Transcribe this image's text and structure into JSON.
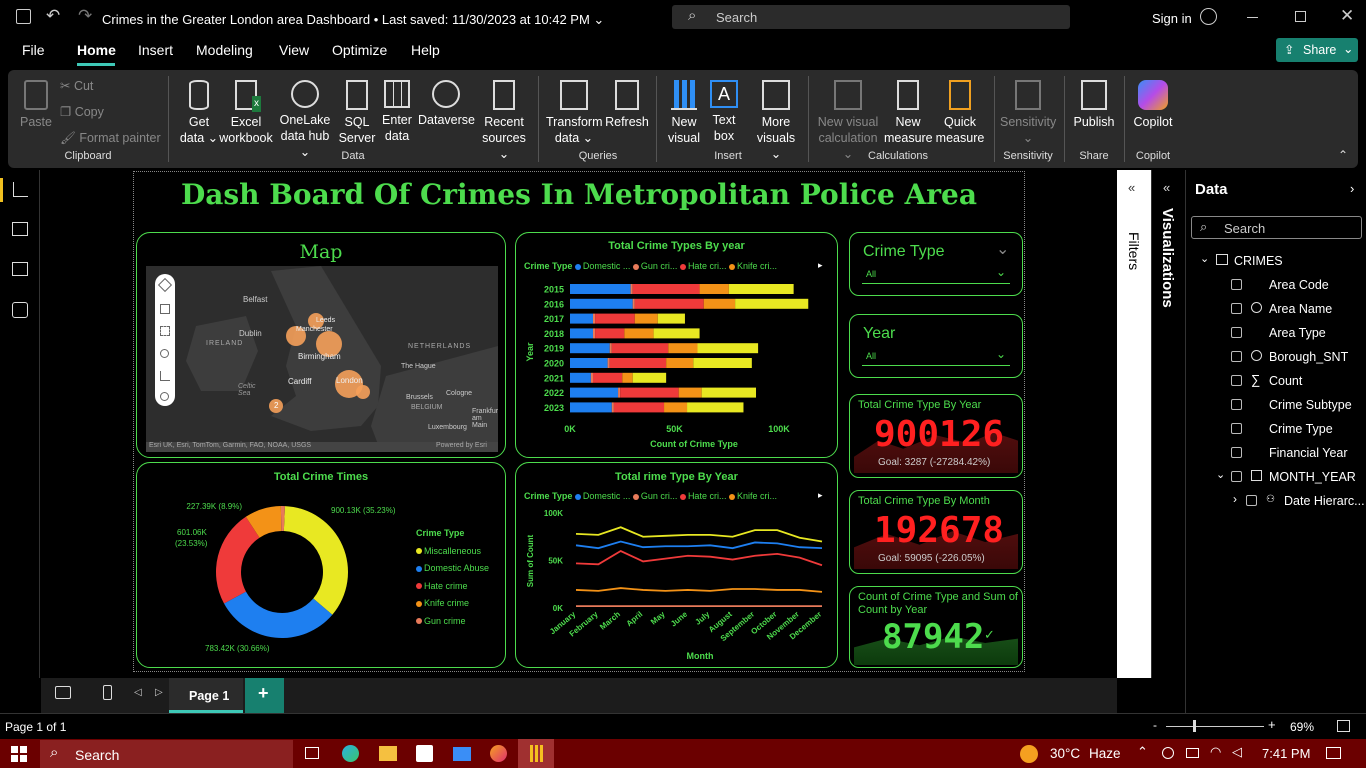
{
  "titlebar": {
    "doc_title": "Crimes in the Greater London area Dashboard",
    "saved": "Last saved: 11/30/2023 at 10:42 PM",
    "search_placeholder": "Search",
    "sign_in": "Sign in"
  },
  "menu": {
    "items": [
      "File",
      "Home",
      "Insert",
      "Modeling",
      "View",
      "Optimize",
      "Help"
    ],
    "share": "Share"
  },
  "ribbon": {
    "paste": "Paste",
    "cut": "Cut",
    "copy": "Copy",
    "format_painter": "Format painter",
    "get_data": [
      "Get",
      "data ⌄"
    ],
    "excel": [
      "Excel",
      "workbook"
    ],
    "onelake": [
      "OneLake",
      "data hub ⌄"
    ],
    "sql": [
      "SQL",
      "Server"
    ],
    "enter": [
      "Enter",
      "data"
    ],
    "dataverse": "Dataverse",
    "recent": [
      "Recent",
      "sources ⌄"
    ],
    "transform": [
      "Transform",
      "data ⌄"
    ],
    "refresh": "Refresh",
    "new_visual": [
      "New",
      "visual"
    ],
    "text_box": [
      "Text",
      "box"
    ],
    "more_visuals": [
      "More",
      "visuals ⌄"
    ],
    "new_visual_calc": [
      "New visual",
      "calculation ⌄"
    ],
    "new_measure": [
      "New",
      "measure"
    ],
    "quick_measure": [
      "Quick",
      "measure"
    ],
    "sensitivity": [
      "Sensitivity",
      "⌄"
    ],
    "publish": "Publish",
    "copilot": "Copilot",
    "sections": {
      "clipboard": "Clipboard",
      "data": "Data",
      "queries": "Queries",
      "insert": "Insert",
      "calculations": "Calculations",
      "sensitivity": "Sensitivity",
      "share": "Share",
      "copilot": "Copilot"
    }
  },
  "dashboard": {
    "title": "Dash Board Of Crimes In Metropolitan Police Area",
    "map": {
      "title": "Map",
      "labels": [
        "Belfast",
        "Dublin",
        "IRELAND",
        "Leeds",
        "Manchester",
        "Birmingham",
        "NETHERLANDS",
        "The Hague",
        "Cardiff",
        "Celtic Sea",
        "London",
        "Brussels",
        "BELGIUM",
        "Cologne",
        "Frankfurt am Main",
        "Luxembourg"
      ],
      "attribution": "Esri UK, Esri, TomTom, Garmin, FAO, NOAA, USGS",
      "powered": "Powered by Esri",
      "cluster_2": "2"
    },
    "slicer_crime_type": {
      "title": "Crime Type",
      "value": "All"
    },
    "slicer_year": {
      "title": "Year",
      "value": "All"
    },
    "kpi1": {
      "title": "Total Crime Type By Year",
      "value": "900126",
      "goal": "Goal: 3287 (-27284.42%)"
    },
    "kpi2": {
      "title": "Total Crime Type By Month",
      "value": "192678",
      "goal": "Goal: 59095 (-226.05%)"
    },
    "kpi3": {
      "title": "Count of Crime Type and Sum of Count by Year",
      "value": "87942"
    }
  },
  "chart_data": [
    {
      "type": "bar",
      "title": "Total Crime Types By year",
      "legend_title": "Crime Type",
      "legend": [
        "Domestic ...",
        "Gun cri...",
        "Hate cri...",
        "Knife cri..."
      ],
      "xlabel": "Count of Crime Type",
      "ylabel": "Year",
      "xticks": [
        "0K",
        "50K",
        "100K"
      ],
      "xlim": [
        0,
        110000
      ],
      "categories": [
        "2015",
        "2016",
        "2017",
        "2018",
        "2019",
        "2020",
        "2021",
        "2022",
        "2023"
      ],
      "series": [
        {
          "name": "Domestic Abuse",
          "color": "#1e7ff0",
          "values": [
            29000,
            30000,
            11000,
            11000,
            19000,
            18000,
            10000,
            23000,
            20000
          ]
        },
        {
          "name": "Gun crime",
          "color": "#e87a5a",
          "values": [
            1000,
            1000,
            1000,
            1000,
            1000,
            1000,
            1000,
            1000,
            1000
          ]
        },
        {
          "name": "Hate crime",
          "color": "#ef3a3a",
          "values": [
            32000,
            33000,
            19000,
            14000,
            27000,
            27000,
            14000,
            28000,
            24000
          ]
        },
        {
          "name": "Knife crime",
          "color": "#f39217",
          "values": [
            14000,
            15000,
            11000,
            14000,
            14000,
            13000,
            5000,
            11000,
            11000
          ]
        },
        {
          "name": "Miscalleneous",
          "color": "#e8e822",
          "values": [
            31000,
            35000,
            13000,
            22000,
            29000,
            28000,
            16000,
            26000,
            27000
          ]
        }
      ]
    },
    {
      "type": "pie",
      "title": "Total Crime Times",
      "legend_title": "Crime Type",
      "labels": [
        "Miscalleneous",
        "Domestic Abuse",
        "Hate crime",
        "Knife crime",
        "Gun crime"
      ],
      "values": [
        900130,
        783420,
        601060,
        227390,
        25000
      ],
      "colors": [
        "#e8e822",
        "#1e7ff0",
        "#ef3a3a",
        "#f39217",
        "#e87a5a"
      ],
      "data_labels": [
        "900.13K (35.23%)",
        "783.42K (30.66%)",
        "601.06K (23.53%)",
        "227.39K (8.9%)"
      ]
    },
    {
      "type": "line",
      "title": "Total rime Type By Year",
      "legend_title": "Crime Type",
      "legend": [
        "Domestic ...",
        "Gun cri...",
        "Hate cri...",
        "Knife cri..."
      ],
      "xlabel": "Month",
      "ylabel": "Sum of Count",
      "yticks": [
        "0K",
        "50K",
        "100K"
      ],
      "ylim": [
        0,
        100000
      ],
      "categories": [
        "January",
        "February",
        "March",
        "April",
        "May",
        "June",
        "July",
        "August",
        "September",
        "October",
        "November",
        "December"
      ],
      "series": [
        {
          "name": "Miscalleneous",
          "color": "#e8e822",
          "values": [
            78000,
            77000,
            85000,
            75000,
            76000,
            77000,
            77000,
            75000,
            82000,
            82000,
            74000,
            70000
          ]
        },
        {
          "name": "Domestic Abuse",
          "color": "#1e7ff0",
          "values": [
            66000,
            63000,
            70000,
            64000,
            65000,
            65000,
            66000,
            63000,
            69000,
            68000,
            64000,
            63000
          ]
        },
        {
          "name": "Hate crime",
          "color": "#ef3a3a",
          "values": [
            47000,
            46000,
            60000,
            49000,
            52000,
            55000,
            54000,
            51000,
            55000,
            57000,
            53000,
            45000
          ]
        },
        {
          "name": "Knife crime",
          "color": "#f39217",
          "values": [
            19000,
            18000,
            21000,
            19000,
            18000,
            19000,
            18000,
            20000,
            20000,
            19000,
            19000,
            17000
          ]
        },
        {
          "name": "Gun crime",
          "color": "#e87a5a",
          "values": [
            2000,
            2000,
            2000,
            2000,
            2000,
            2000,
            2000,
            2000,
            2000,
            2000,
            2000,
            2000
          ]
        }
      ]
    }
  ],
  "panes": {
    "filters": "Filters",
    "visualizations": "Visualizations",
    "data_title": "Data",
    "search_placeholder": "Search",
    "table": "CRIMES",
    "fields": [
      "Area Code",
      "Area Name",
      "Area Type",
      "Borough_SNT",
      "Count",
      "Crime Subtype",
      "Crime Type",
      "Financial Year",
      "MONTH_YEAR",
      "Date Hierarc..."
    ]
  },
  "pages": {
    "tab": "Page 1",
    "add": "+"
  },
  "status": {
    "page": "Page 1 of 1",
    "zoom": "69%"
  },
  "taskbar": {
    "search": "Search",
    "weather": "30°C",
    "weather_desc": "Haze",
    "time": "7:41 PM"
  }
}
